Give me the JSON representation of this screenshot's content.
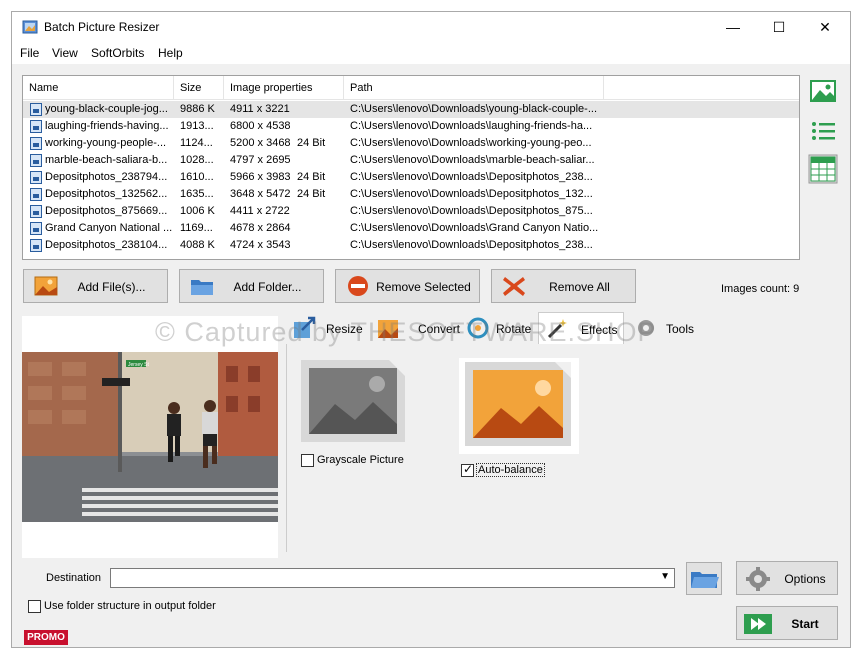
{
  "window": {
    "title": "Batch Picture Resizer",
    "controls": [
      "—",
      "☐",
      "✕"
    ]
  },
  "menu": [
    "File",
    "View",
    "SoftOrbits",
    "Help"
  ],
  "file_list": {
    "columns": [
      "Name",
      "Size",
      "Image properties",
      "Path"
    ],
    "rows": [
      {
        "name": "young-black-couple-jog...",
        "size": "9886 K",
        "props": "4911 x 3221",
        "bits": "",
        "path": "C:\\Users\\lenovo\\Downloads\\young-black-couple-..."
      },
      {
        "name": "laughing-friends-having...",
        "size": "1913...",
        "props": "6800 x 4538",
        "bits": "",
        "path": "C:\\Users\\lenovo\\Downloads\\laughing-friends-ha..."
      },
      {
        "name": "working-young-people-...",
        "size": "1124...",
        "props": "5200 x 3468",
        "bits": "24 Bit",
        "path": "C:\\Users\\lenovo\\Downloads\\working-young-peo..."
      },
      {
        "name": "marble-beach-saliara-b...",
        "size": "1028...",
        "props": "4797 x 2695",
        "bits": "",
        "path": "C:\\Users\\lenovo\\Downloads\\marble-beach-saliar..."
      },
      {
        "name": "Depositphotos_238794...",
        "size": "1610...",
        "props": "5966 x 3983",
        "bits": "24 Bit",
        "path": "C:\\Users\\lenovo\\Downloads\\Depositphotos_238..."
      },
      {
        "name": "Depositphotos_132562...",
        "size": "1635...",
        "props": "3648 x 5472",
        "bits": "24 Bit",
        "path": "C:\\Users\\lenovo\\Downloads\\Depositphotos_132..."
      },
      {
        "name": "Depositphotos_875669...",
        "size": "1006 K",
        "props": "4411 x 2722",
        "bits": "",
        "path": "C:\\Users\\lenovo\\Downloads\\Depositphotos_875..."
      },
      {
        "name": "Grand Canyon National ...",
        "size": "1169...",
        "props": "4678 x 2864",
        "bits": "",
        "path": "C:\\Users\\lenovo\\Downloads\\Grand Canyon Natio..."
      },
      {
        "name": "Depositphotos_238104...",
        "size": "4088 K",
        "props": "4724 x 3543",
        "bits": "",
        "path": "C:\\Users\\lenovo\\Downloads\\Depositphotos_238..."
      }
    ]
  },
  "buttons": {
    "add_files": "Add File(s)...",
    "add_folder": "Add Folder...",
    "remove_selected": "Remove Selected",
    "remove_all": "Remove All"
  },
  "images_count": "Images count: 9",
  "tabs": [
    "Resize",
    "Convert",
    "Rotate",
    "Effects",
    "Tools"
  ],
  "active_tab": "Effects",
  "effects": [
    {
      "label": "Grayscale Picture",
      "checked": false
    },
    {
      "label": "Auto-balance",
      "checked": true
    }
  ],
  "destination": {
    "label": "Destination",
    "value": ""
  },
  "options_label": "Options",
  "start_label": "Start",
  "folder_structure_label": "Use folder structure in output folder",
  "promo": "PROMO",
  "watermark": "© Captured by THESOFTWARE.SHOP",
  "preview_sign": "Jersey St",
  "colors": {
    "accent_green": "#2e9e4f",
    "remove_red": "#d9481c",
    "promo_red": "#c8102e"
  }
}
